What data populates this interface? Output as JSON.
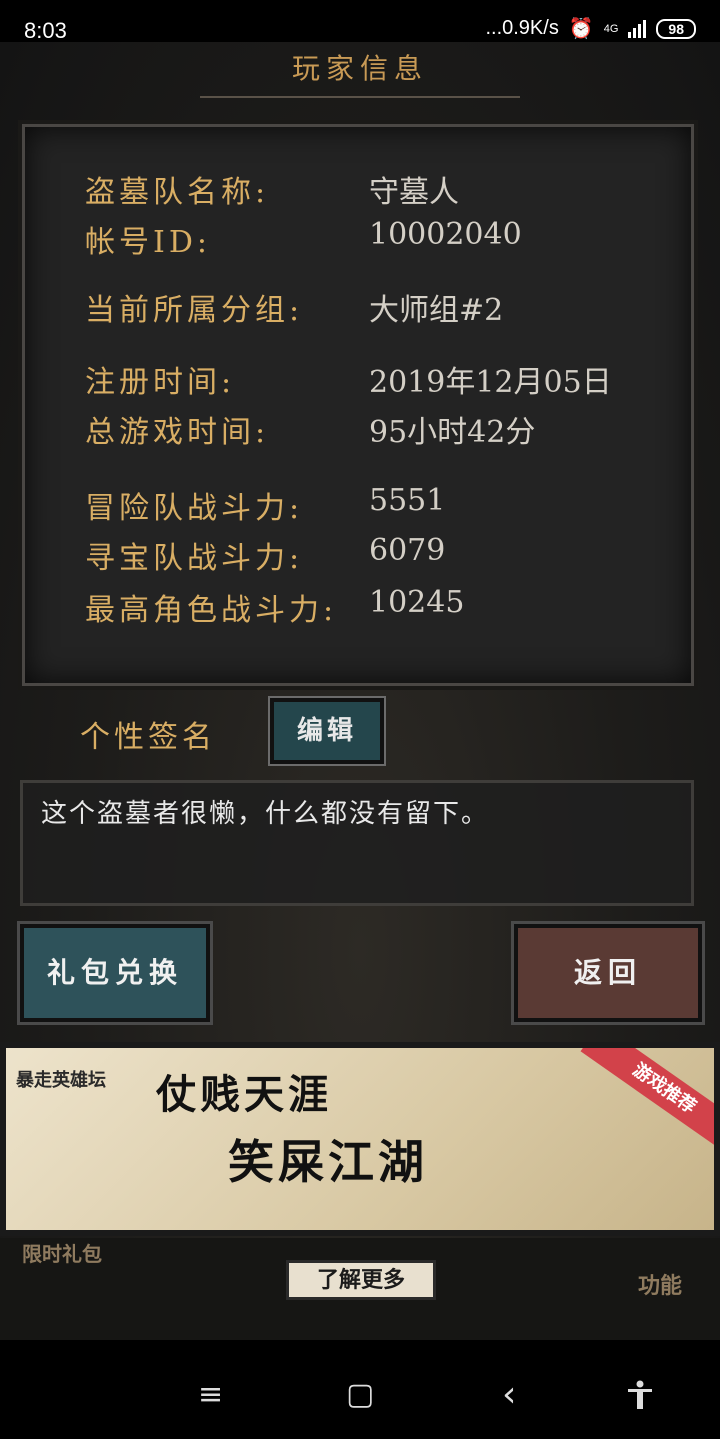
{
  "status": {
    "time": "8:03",
    "network_speed": "...0.9K/s",
    "network_type": "4G",
    "battery": "98"
  },
  "page": {
    "title": "玩家信息"
  },
  "player": {
    "rows": [
      {
        "label": "盗墓队名称:",
        "value": "守墓人"
      },
      {
        "label": "帐号ID:",
        "value": "10002040"
      },
      {
        "label": "当前所属分组:",
        "value": "大师组#2"
      },
      {
        "label": "注册时间:",
        "value": "2019年12月05日"
      },
      {
        "label": "总游戏时间:",
        "value": "95小时42分"
      },
      {
        "label": "冒险队战斗力:",
        "value": "5551"
      },
      {
        "label": "寻宝队战斗力:",
        "value": "6079"
      },
      {
        "label": "最高角色战斗力:",
        "value": "10245"
      }
    ]
  },
  "signature": {
    "label": "个性签名",
    "edit_label": "编辑",
    "text": "这个盗墓者很懒，什么都没有留下。"
  },
  "buttons": {
    "gift_exchange": "礼包兑换",
    "back": "返回"
  },
  "ad": {
    "logo": "暴走英雄坛",
    "line1": "仗贱天涯",
    "line2": "笑屎江湖",
    "ribbon": "游戏推荐"
  },
  "bottom_nav": {
    "limited_gift": "限时礼包",
    "learn_more": "了解更多",
    "function": "功能"
  },
  "system_nav": {
    "menu_icon": "≡",
    "home_icon": "▢",
    "back_icon": "‹",
    "accessibility_icon": "accessibility"
  }
}
